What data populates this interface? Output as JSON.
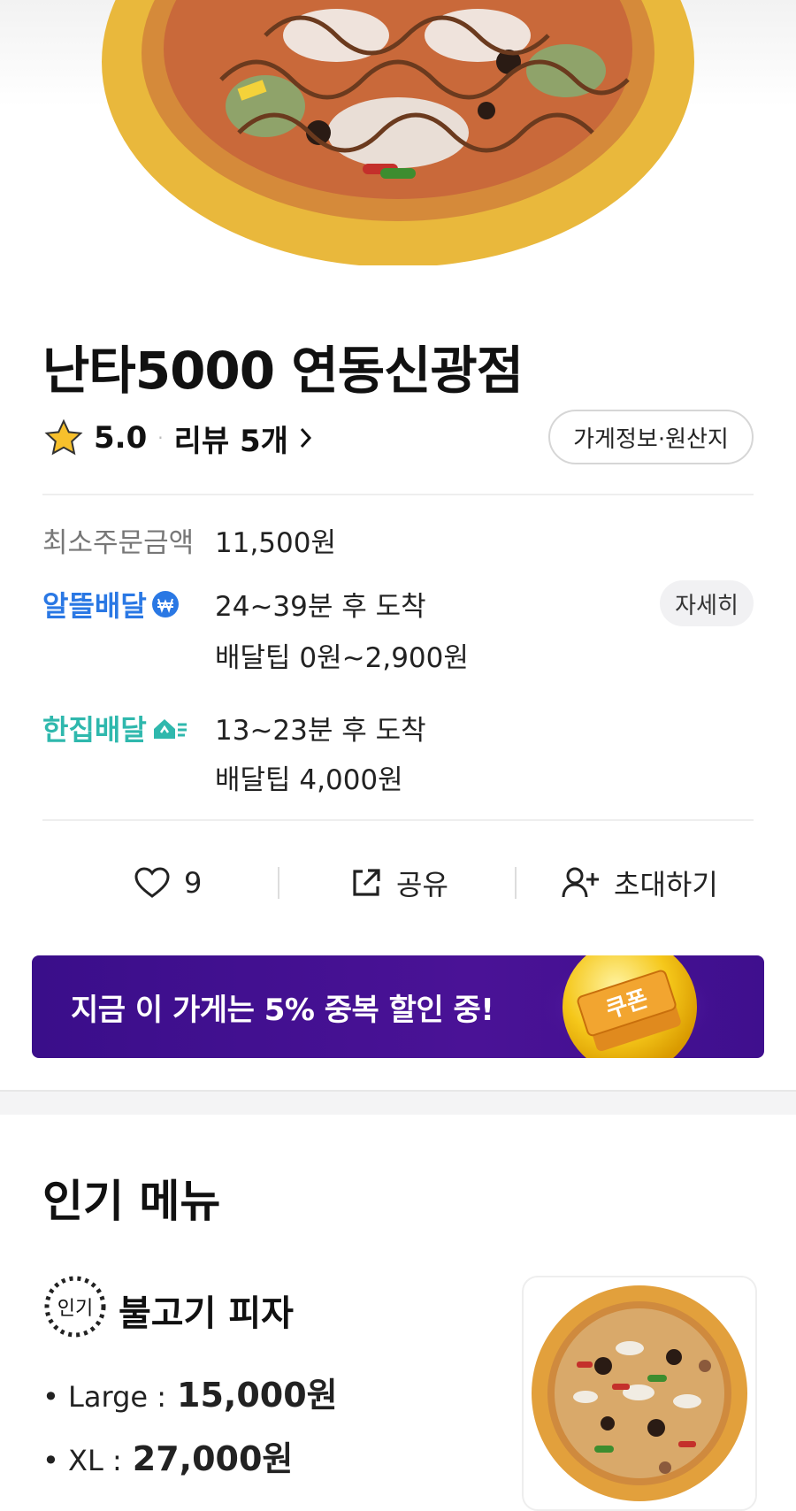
{
  "store": {
    "name": "난타5000 연동신광점",
    "rating": "5.0",
    "rating_sep": "·",
    "review_link": "리뷰 5개",
    "info_button": "가게정보·원산지"
  },
  "order_info": {
    "min_order_label": "최소주문금액",
    "min_order_value": "11,500원",
    "delivery_options": [
      {
        "label": "알뜰배달",
        "time": "24~39분 후 도착",
        "tip": "배달팁 0원~2,900원",
        "color": "#2a78e4"
      },
      {
        "label": "한집배달",
        "time": "13~23분 후 도착",
        "tip": "배달팁 4,000원",
        "color": "#2fb8ad"
      }
    ],
    "detail_button": "자세히"
  },
  "actions": {
    "like_count": "9",
    "share_label": "공유",
    "invite_label": "초대하기"
  },
  "banner": {
    "text": "지금 이 가게는 5% 중복 할인 중!",
    "coupon_label": "쿠폰"
  },
  "popular_menu": {
    "title": "인기 메뉴",
    "badge": "인기",
    "items": [
      {
        "name": "불고기 피자",
        "prices": [
          {
            "size": "• Large :",
            "price": "15,000원"
          },
          {
            "size": "• XL :",
            "price": "27,000원"
          }
        ]
      }
    ]
  },
  "colors": {
    "banner_bg": "#3a0e8a",
    "alddeul": "#2a78e4",
    "hanjip": "#2fb8ad"
  }
}
